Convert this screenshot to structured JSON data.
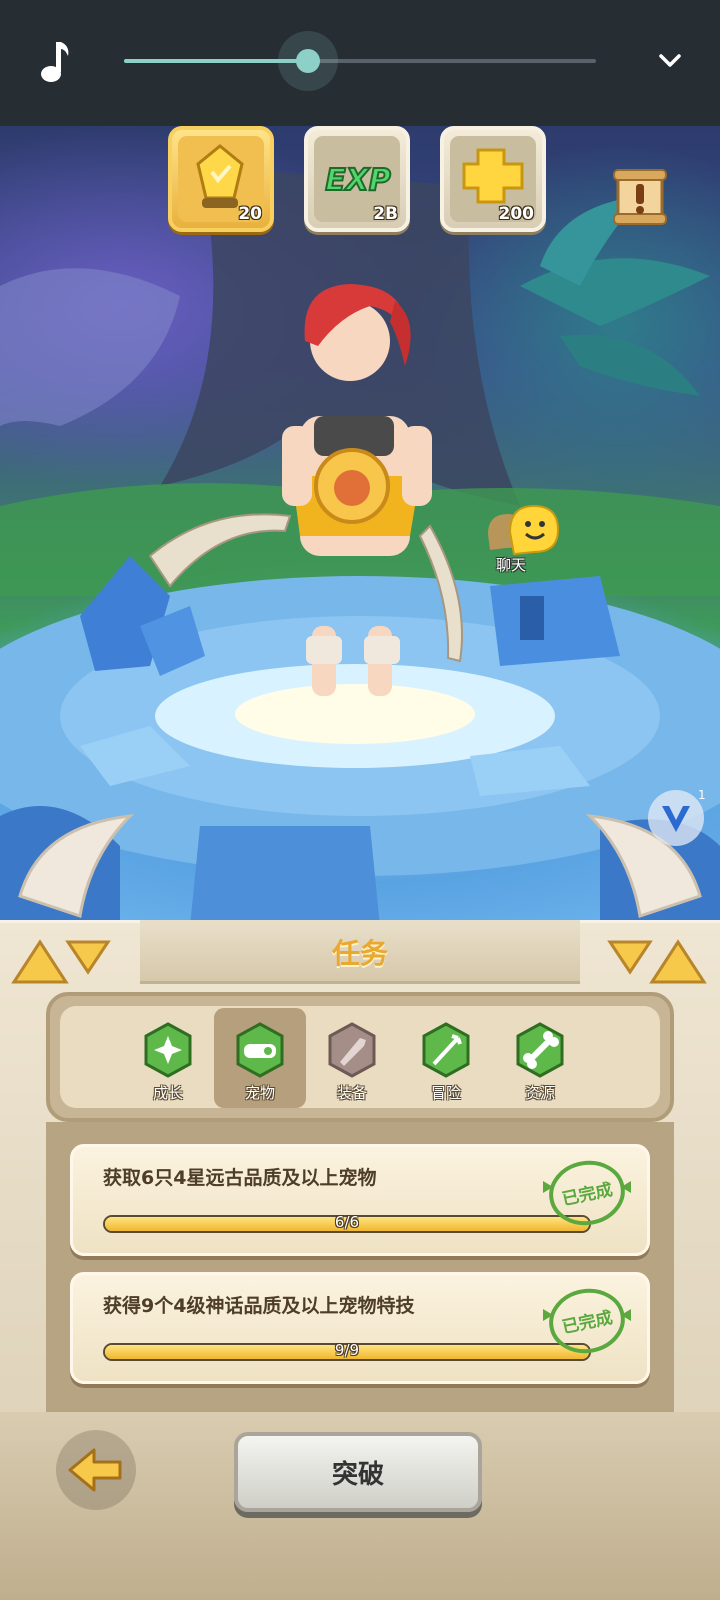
{
  "media_bar": {
    "music_icon": "music-note-icon",
    "progress": 0.39,
    "collapse_icon": "chevron-down-icon"
  },
  "resources": [
    {
      "icon": "gold-crystal-icon",
      "count": "20",
      "selected": true
    },
    {
      "icon": "exp-icon",
      "label": "EXP",
      "count": "2B",
      "selected": false
    },
    {
      "icon": "gold-puzzle-icon",
      "count": "200",
      "selected": false
    }
  ],
  "scene": {
    "chat_label": "聊天",
    "v_badge_count": "1"
  },
  "panel": {
    "title": "任务",
    "tabs": [
      {
        "label": "成长",
        "icon": "growth-icon",
        "active": false,
        "color": "#5fb84a"
      },
      {
        "label": "宠物",
        "icon": "pet-icon",
        "active": true,
        "color": "#5fb84a"
      },
      {
        "label": "装备",
        "icon": "equipment-icon",
        "active": false,
        "color": "#a58d88"
      },
      {
        "label": "冒险",
        "icon": "adventure-icon",
        "active": false,
        "color": "#5fb84a"
      },
      {
        "label": "资源",
        "icon": "resource-bone-icon",
        "active": false,
        "color": "#5fb84a"
      }
    ],
    "tasks": [
      {
        "title": "获取6只4星远古品质及以上宠物",
        "progress_text": "6/6",
        "progress": 1.0,
        "stamp": "已完成"
      },
      {
        "title": "获得9个4级神话品质及以上宠物特技",
        "progress_text": "9/9",
        "progress": 1.0,
        "stamp": "已完成"
      }
    ],
    "breakthrough_label": "突破"
  },
  "colors": {
    "accent": "#e9a830",
    "stamp_green": "#5ba83f",
    "progress_fill": "#f0b630"
  }
}
